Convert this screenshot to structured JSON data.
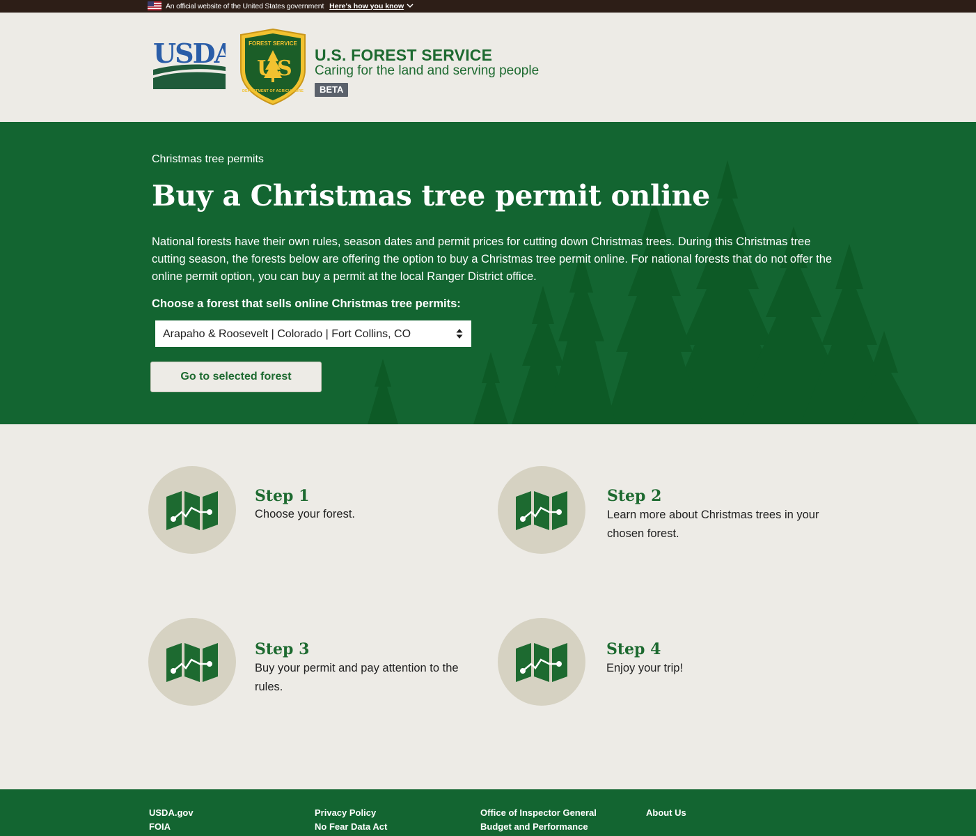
{
  "gov_banner": {
    "text": "An official website of the United States government",
    "link": "Here's how you know"
  },
  "header": {
    "agency_name": "U.S. FOREST SERVICE",
    "tagline": "Caring for the land and serving people",
    "badge": "BETA",
    "usda_logo_text": "USDA",
    "shield_text_top": "FOREST SERVICE",
    "shield_text_bottom": "DEPARTMENT OF AGRICULTURE"
  },
  "hero": {
    "breadcrumb": "Christmas tree permits",
    "title": "Buy a Christmas tree permit online",
    "intro": "National forests have their own rules, season dates and permit prices for cutting down Christmas trees. During this Christmas tree cutting season, the forests below are offering the option to buy a Christmas tree permit online. For national forests that do not offer the online permit option, you can buy a permit at the local Ranger District office.",
    "select_label": "Choose a forest that sells online Christmas tree permits:",
    "selected_forest": "Arapaho & Roosevelt | Colorado | Fort Collins, CO",
    "button_label": "Go to selected forest"
  },
  "steps": [
    {
      "title": "Step 1",
      "text": "Choose your forest.",
      "icon": "map-icon"
    },
    {
      "title": "Step 2",
      "text": "Learn more about Christmas trees in your chosen forest.",
      "icon": "map-icon"
    },
    {
      "title": "Step 3",
      "text": "Buy your permit and pay attention to the rules.",
      "icon": "map-icon"
    },
    {
      "title": "Step 4",
      "text": "Enjoy your trip!",
      "icon": "map-icon"
    }
  ],
  "footer": {
    "links": [
      "USDA.gov",
      "FOIA",
      "Privacy Policy",
      "No Fear Data Act",
      "Office of Inspector General",
      "Budget and Performance",
      "About Us"
    ]
  },
  "colors": {
    "forest_green": "#136531",
    "text_green": "#1d6a30",
    "banner_brown": "#2d1e17",
    "page_bg": "#edebe6",
    "step_circle": "#d6d2c2"
  }
}
